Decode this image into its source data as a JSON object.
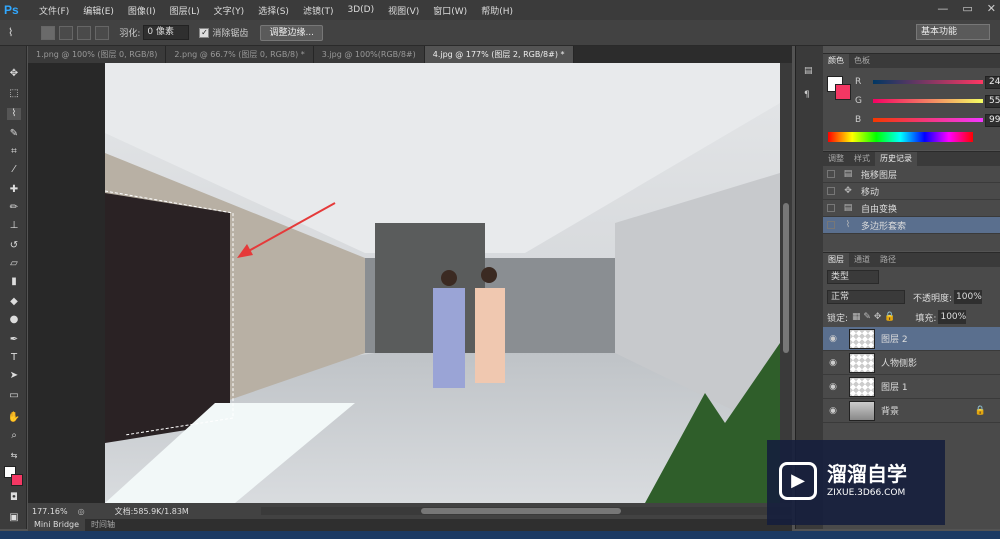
{
  "menubar": {
    "logo": "Ps",
    "items": [
      "文件(F)",
      "编辑(E)",
      "图像(I)",
      "图层(L)",
      "文字(Y)",
      "选择(S)",
      "滤镜(T)",
      "3D(D)",
      "视图(V)",
      "窗口(W)",
      "帮助(H)"
    ],
    "controls": [
      "—",
      "▭",
      "✕"
    ]
  },
  "options": {
    "feather_label": "羽化:",
    "feather_value": "0 像素",
    "antialias_label": "消除锯齿",
    "refine_edge": "调整边缘...",
    "workspace": "基本功能"
  },
  "doc_tabs": [
    "1.png @ 100% (图层 0, RGB/8)",
    "2.png @ 66.7% (图层 0, RGB/8) *",
    "3.jpg @ 100%(RGB/8#)",
    "4.jpg @ 177% (图层 2, RGB/8#) *"
  ],
  "status": {
    "zoom": "177.16%",
    "doc": "文档:585.9K/1.83M"
  },
  "bottom_tabs": [
    "Mini Bridge",
    "时间轴"
  ],
  "color_panel": {
    "tabs": [
      "颜色",
      "色板"
    ],
    "r_label": "R",
    "g_label": "G",
    "b_label": "B",
    "r": "244",
    "g": "55",
    "b": "99",
    "fg_color": "#f43763",
    "bg_color": "#ffffff"
  },
  "history_panel": {
    "tabs": [
      "调整",
      "样式",
      "历史记录"
    ],
    "items": [
      "拖移图层",
      "移动",
      "自由变换",
      "多边形套索"
    ]
  },
  "layers_panel": {
    "tabs": [
      "图层",
      "通道",
      "路径"
    ],
    "kind": "类型",
    "blend": "正常",
    "opacity_label": "不透明度:",
    "opacity": "100%",
    "lock_label": "锁定:",
    "fill_label": "填充:",
    "fill": "100%",
    "layers": [
      "图层 2",
      "人物侧影",
      "图层 1",
      "背景"
    ]
  },
  "watermark": {
    "title": "溜溜自学",
    "url": "ZIXUE.3D66.COM"
  }
}
